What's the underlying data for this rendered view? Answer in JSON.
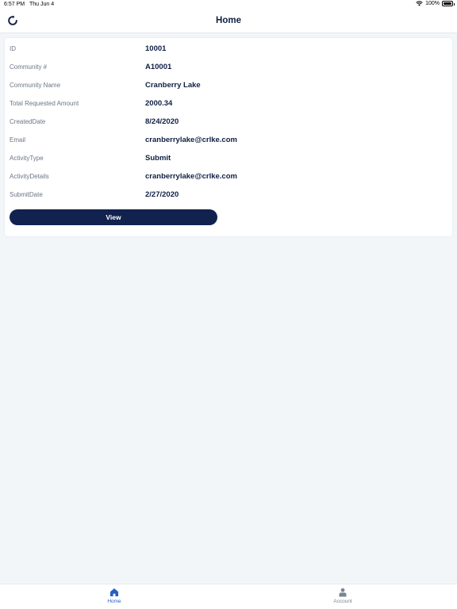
{
  "status_bar": {
    "time": "6:57 PM",
    "date": "Thu Jun 4",
    "battery": "100%"
  },
  "nav": {
    "title": "Home"
  },
  "details": [
    {
      "label": "ID",
      "value": "10001"
    },
    {
      "label": "Community #",
      "value": "A10001"
    },
    {
      "label": "Community Name",
      "value": "Cranberry Lake"
    },
    {
      "label": "Total Requested Amount",
      "value": "2000.34"
    },
    {
      "label": "CreatedDate",
      "value": "8/24/2020"
    },
    {
      "label": "Email",
      "value": "cranberrylake@crlke.com"
    },
    {
      "label": "ActivityType",
      "value": "Submit"
    },
    {
      "label": "ActivityDetails",
      "value": "cranberrylake@crlke.com"
    },
    {
      "label": "SubmitDate",
      "value": "2/27/2020"
    }
  ],
  "view_button": {
    "label": "View"
  },
  "tabs": [
    {
      "label": "Home",
      "icon": "home-icon"
    },
    {
      "label": "Account",
      "icon": "person-icon"
    }
  ],
  "colors": {
    "primary": "#12224e",
    "active_tab": "#2a5fc4",
    "inactive_tab": "#7a8494",
    "background": "#f3f6f9"
  }
}
